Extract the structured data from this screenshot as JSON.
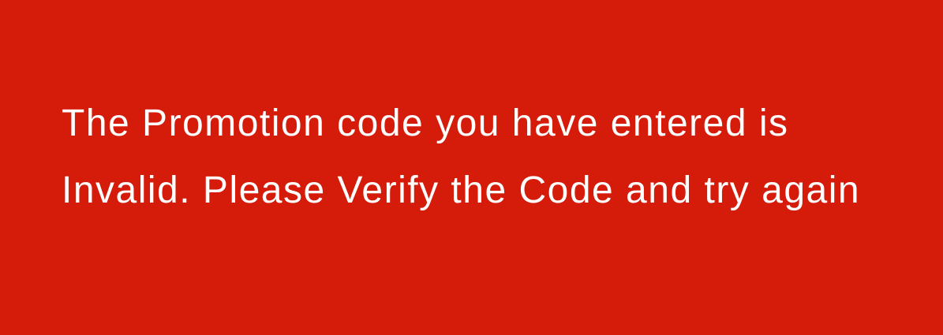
{
  "banner": {
    "background_color": "#d51b0a",
    "text_color": "#ffffff",
    "message": "The Promotion code you have entered is Invalid. Please Verify the Code and try again"
  }
}
